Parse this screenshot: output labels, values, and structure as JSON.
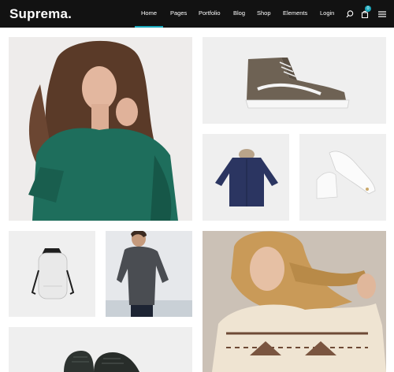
{
  "header": {
    "logo": "Suprema.",
    "nav": [
      {
        "label": "Home"
      },
      {
        "label": "Pages"
      },
      {
        "label": "Portfolio"
      },
      {
        "label": "Blog"
      },
      {
        "label": "Shop"
      },
      {
        "label": "Elements"
      },
      {
        "label": "Login"
      }
    ],
    "active_nav": "Home",
    "cart_count": "0",
    "accent_color": "#1aa9bd",
    "icons": [
      "search-icon",
      "cart-icon",
      "menu-icon"
    ]
  },
  "gallery": {
    "tiles": [
      {
        "name": "woman-green-sweater-photo"
      },
      {
        "name": "sneaker-photo"
      },
      {
        "name": "navy-parka-photo"
      },
      {
        "name": "white-sneakers-photo"
      },
      {
        "name": "white-backpack-photo"
      },
      {
        "name": "man-grey-sweater-photo"
      },
      {
        "name": "woman-patterned-sweater-photo"
      },
      {
        "name": "black-shoes-photo"
      }
    ]
  }
}
